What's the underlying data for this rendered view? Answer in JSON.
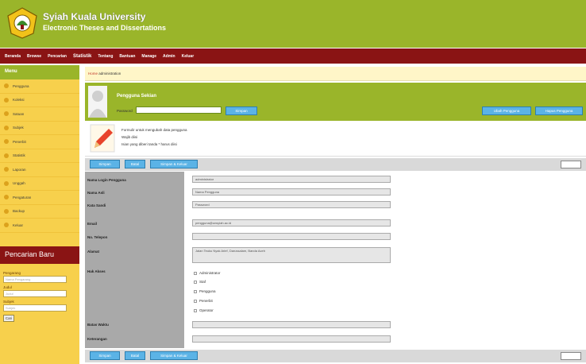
{
  "header": {
    "title": "Syiah Kuala University",
    "subtitle": "Electronic Theses and Dissertations"
  },
  "nav": {
    "items": [
      "Beranda",
      "Browse",
      "Pencarian",
      "Statistik",
      "Tentang",
      "Bantuan",
      "Manage",
      "Admin",
      "Keluar"
    ]
  },
  "sidebar": {
    "heading": "Menu",
    "items": [
      "Pengguna",
      "Koleksi",
      "Satuan",
      "Subjek",
      "Penerbit",
      "Statistik",
      "Laporan",
      "Unggah",
      "Pengaturan",
      "Backup",
      "Keluar"
    ],
    "recent_title": "Pencarian Baru",
    "search_fields": [
      {
        "label": "Pengarang",
        "placeholder": "Nama Pengarang"
      },
      {
        "label": "Judul",
        "placeholder": "Judul"
      },
      {
        "label": "Subjek",
        "placeholder": "Subjek"
      }
    ],
    "go_label": "Cari"
  },
  "breadcrumb": {
    "link": "Home",
    "current": "administration"
  },
  "user_panel": {
    "name": "Pengguna Sekian",
    "password_label": "Password",
    "password_button": "Simpan",
    "btn_left": "Ubah Pengguna",
    "btn_right": "Hapus Pengguna"
  },
  "info": {
    "lines": [
      "Formulir untuk mengubah data pengguna",
      "Wajib diisi",
      "Isian yang diberi tanda * harus diisi"
    ]
  },
  "toolbar": {
    "b1": "Simpan",
    "b2": "Batal",
    "b3": "Simpan & Keluar"
  },
  "form": {
    "fields": [
      {
        "label": "Nama Login Pengguna",
        "value": "administrator"
      },
      {
        "label": "Nama Asli",
        "value": "Nama Pengguna"
      },
      {
        "label": "Kata Sandi",
        "value": "Password"
      },
      {
        "label": "Email",
        "value": "pengguna@unsyiah.ac.id"
      },
      {
        "label": "No. Telepon",
        "value": ""
      },
      {
        "label": "Alamat",
        "value": "Jalan Teuku Nyak Arief, Darussalam, Banda Aceh"
      }
    ],
    "roles_label": "Hak Akses",
    "roles": [
      "Administrator",
      "Staf",
      "Pengguna",
      "Penerbit",
      "Operator"
    ],
    "extra_fields": [
      {
        "label": "Batas Waktu",
        "value": ""
      },
      {
        "label": "Keterangan",
        "value": ""
      }
    ]
  },
  "colors": {
    "header": "#9ab52a",
    "nav": "#8a1414",
    "sidebar": "#f7d04c",
    "button": "#5bb3e6"
  }
}
